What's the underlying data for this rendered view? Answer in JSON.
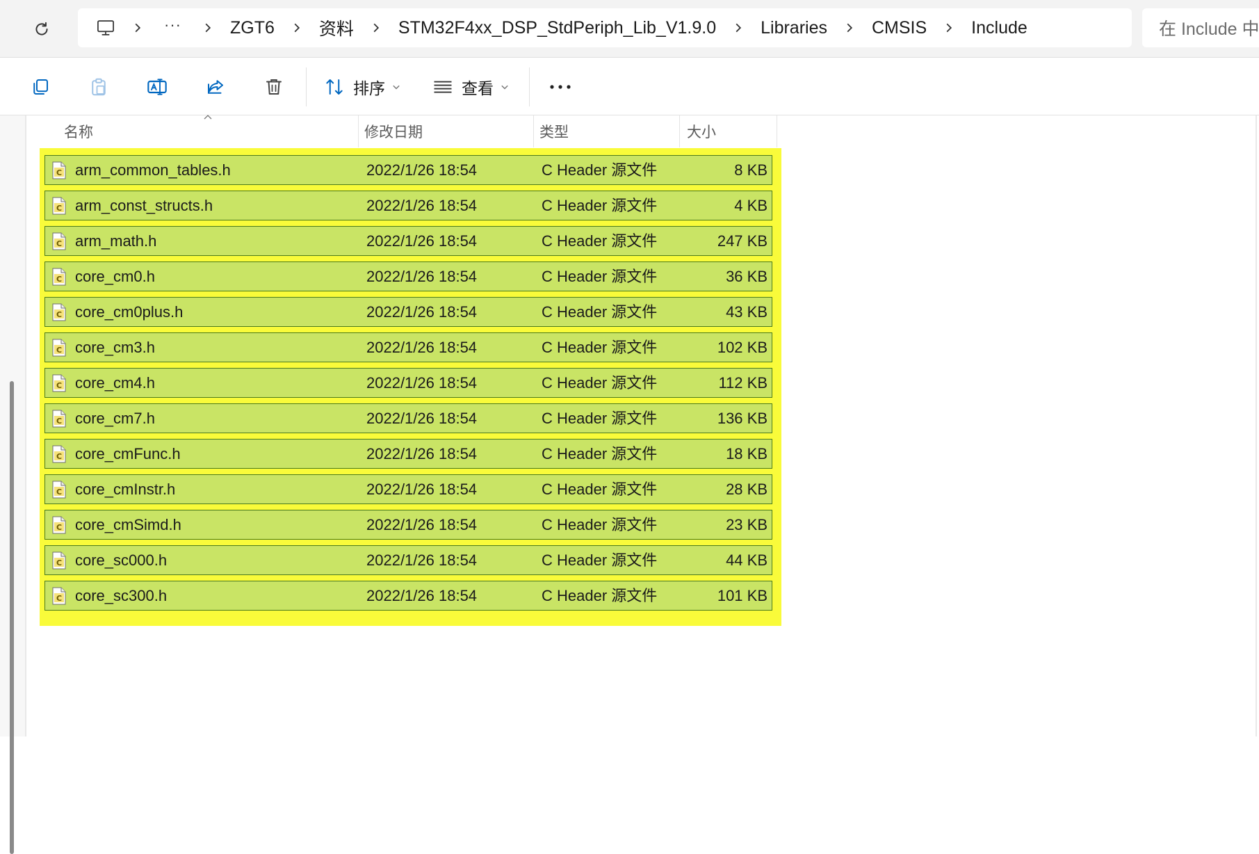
{
  "address_bar": {
    "breadcrumb": {
      "overflow": "···",
      "items": [
        "ZGT6",
        "资料",
        "STM32F4xx_DSP_StdPeriph_Lib_V1.9.0",
        "Libraries",
        "CMSIS",
        "Include"
      ]
    },
    "search_placeholder": "在 Include 中"
  },
  "toolbar": {
    "sort_label": "排序",
    "view_label": "查看"
  },
  "columns": {
    "name": "名称",
    "modified": "修改日期",
    "type": "类型",
    "size": "大小"
  },
  "files": [
    {
      "name": "arm_common_tables.h",
      "modified": "2022/1/26 18:54",
      "type": "C Header 源文件",
      "size": "8 KB"
    },
    {
      "name": "arm_const_structs.h",
      "modified": "2022/1/26 18:54",
      "type": "C Header 源文件",
      "size": "4 KB"
    },
    {
      "name": "arm_math.h",
      "modified": "2022/1/26 18:54",
      "type": "C Header 源文件",
      "size": "247 KB"
    },
    {
      "name": "core_cm0.h",
      "modified": "2022/1/26 18:54",
      "type": "C Header 源文件",
      "size": "36 KB"
    },
    {
      "name": "core_cm0plus.h",
      "modified": "2022/1/26 18:54",
      "type": "C Header 源文件",
      "size": "43 KB"
    },
    {
      "name": "core_cm3.h",
      "modified": "2022/1/26 18:54",
      "type": "C Header 源文件",
      "size": "102 KB"
    },
    {
      "name": "core_cm4.h",
      "modified": "2022/1/26 18:54",
      "type": "C Header 源文件",
      "size": "112 KB"
    },
    {
      "name": "core_cm7.h",
      "modified": "2022/1/26 18:54",
      "type": "C Header 源文件",
      "size": "136 KB"
    },
    {
      "name": "core_cmFunc.h",
      "modified": "2022/1/26 18:54",
      "type": "C Header 源文件",
      "size": "18 KB"
    },
    {
      "name": "core_cmInstr.h",
      "modified": "2022/1/26 18:54",
      "type": "C Header 源文件",
      "size": "28 KB"
    },
    {
      "name": "core_cmSimd.h",
      "modified": "2022/1/26 18:54",
      "type": "C Header 源文件",
      "size": "23 KB"
    },
    {
      "name": "core_sc000.h",
      "modified": "2022/1/26 18:54",
      "type": "C Header 源文件",
      "size": "44 KB"
    },
    {
      "name": "core_sc300.h",
      "modified": "2022/1/26 18:54",
      "type": "C Header 源文件",
      "size": "101 KB"
    }
  ],
  "colors": {
    "highlight": "#f9fb3a",
    "row_fill": "#c9e465",
    "row_border": "#4a7a1a",
    "accent": "#0067c0"
  },
  "icons": {
    "refresh": "refresh-icon",
    "this_pc": "computer-icon",
    "file": "c-header-file-icon"
  }
}
